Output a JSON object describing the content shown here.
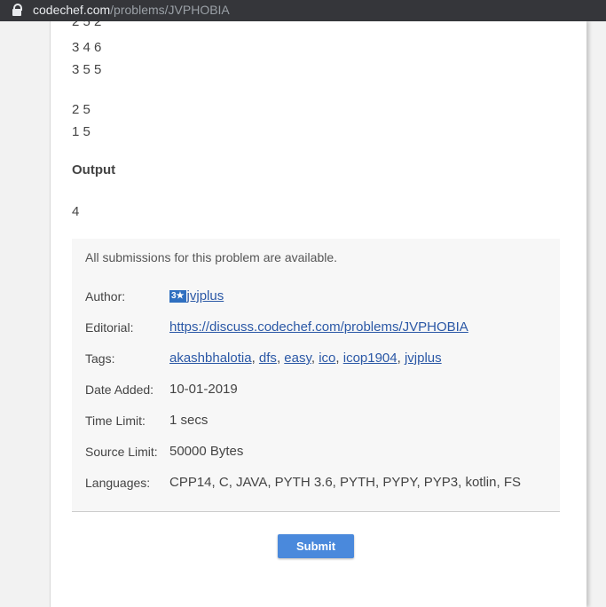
{
  "browser": {
    "url_domain": "codechef.com",
    "url_path": "/problems/JVPHOBIA"
  },
  "sample": {
    "top_partial": "2 5 2",
    "lines_group1": [
      "3 4 6",
      "3 5 5"
    ],
    "lines_group2": [
      "2 5",
      "1 5"
    ],
    "output_heading": "Output",
    "output_value": "4"
  },
  "info": {
    "note": "All submissions for this problem are available.",
    "author_label": "Author:",
    "author_badge": "3★",
    "author_name": "jvjplus",
    "editorial_label": "Editorial:",
    "editorial_link": "https://discuss.codechef.com/problems/JVPHOBIA",
    "tags_label": "Tags:",
    "tags": [
      "akashbhalotia",
      "dfs",
      "easy",
      "ico",
      "icop1904",
      "jvjplus"
    ],
    "date_label": "Date Added:",
    "date_value": "10-01-2019",
    "time_label": "Time Limit:",
    "time_value": "1 secs",
    "source_label": "Source Limit:",
    "source_value": "50000 Bytes",
    "languages_label": "Languages:",
    "languages_value": "CPP14, C, JAVA, PYTH 3.6, PYTH, PYPY, PYP3, kotlin, FS"
  },
  "submit_label": "Submit"
}
